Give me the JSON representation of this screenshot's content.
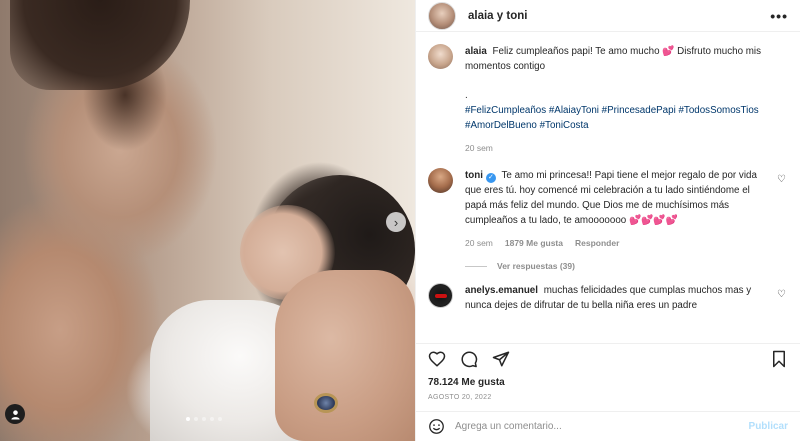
{
  "header": {
    "username": "alaia y toni",
    "more_icon": "more-horizontal-icon"
  },
  "caption": {
    "username": "alaia",
    "text": "Feliz cumpleaños papi! Te amo mucho 💕  Disfruto mucho mis momentos contigo",
    "dot": ".",
    "hashtags": "#FelizCumpleaños #AlaiayToni #PrincesadePapi #TodosSomosTios #AmorDelBueno #ToniCosta",
    "time": "20 sem"
  },
  "comments": [
    {
      "username": "toni",
      "verified": true,
      "text": "Te amo mi princesa!! Papi tiene el mejor regalo de por vida que eres tú. hoy comencé mi celebración a tu lado sintiéndome el papá más feliz del mundo. Que Dios me de muchísimos más cumpleaños a tu lado, te amooooooo 💕💕💕💕",
      "time": "20 sem",
      "likes": "1879 Me gusta",
      "reply": "Responder",
      "view_replies": "Ver respuestas (39)"
    },
    {
      "username": "anelys.emanuel",
      "text": "muchas felicidades que cumplas muchos mas y nunca dejes de difrutar de tu bella niña eres un padre"
    }
  ],
  "post": {
    "likes": "78.124 Me gusta",
    "date": "AGOSTO 20, 2022"
  },
  "add_comment": {
    "placeholder": "Agrega un comentario...",
    "publish": "Publicar"
  },
  "carousel": {
    "slide_count": 5,
    "active_index": 0
  }
}
